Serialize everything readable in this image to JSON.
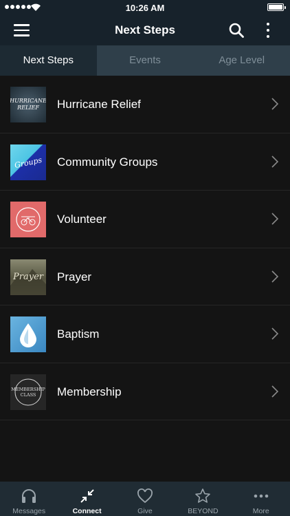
{
  "status_bar": {
    "time": "10:26 AM"
  },
  "nav": {
    "title": "Next Steps"
  },
  "tabs": [
    {
      "label": "Next Steps",
      "active": true
    },
    {
      "label": "Events",
      "active": false
    },
    {
      "label": "Age Level",
      "active": false
    }
  ],
  "items": [
    {
      "label": "Hurricane Relief",
      "thumb_text": "HURRICANE RELIEF",
      "thumb_icon": "hurricane-thumbnail"
    },
    {
      "label": "Community Groups",
      "thumb_text": "Groups",
      "thumb_icon": "groups-thumbnail"
    },
    {
      "label": "Volunteer",
      "thumb_icon": "bicycle-thumbnail"
    },
    {
      "label": "Prayer",
      "thumb_text": "Prayer",
      "thumb_icon": "prayer-thumbnail"
    },
    {
      "label": "Baptism",
      "thumb_icon": "water-drop-thumbnail"
    },
    {
      "label": "Membership",
      "thumb_text": "MEMBERSHIP CLASS",
      "thumb_icon": "membership-thumbnail"
    }
  ],
  "tab_bar": [
    {
      "label": "Messages",
      "icon": "headphones-icon",
      "active": false
    },
    {
      "label": "Connect",
      "icon": "arrows-inward-icon",
      "active": true
    },
    {
      "label": "Give",
      "icon": "heart-icon",
      "active": false
    },
    {
      "label": "BEYOND",
      "icon": "star-icon",
      "active": false
    },
    {
      "label": "More",
      "icon": "ellipsis-icon",
      "active": false
    }
  ],
  "colors": {
    "nav_bg": "#17222b",
    "tab_bg": "#2f3f4a",
    "active_tab_bg": "#1d2a33",
    "list_bg": "#141414",
    "tab_bar_bg": "#202c34"
  }
}
